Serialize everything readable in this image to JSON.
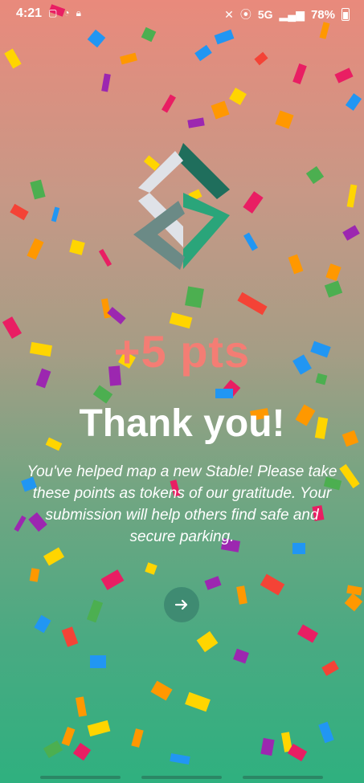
{
  "status_bar": {
    "time": "4:21",
    "network": "5G",
    "battery": "78%"
  },
  "main": {
    "points": "+5 pts",
    "title": "Thank you!",
    "message": "You've helped map a new Stable! Please take these points as tokens of our gratitude. Your submission will help others find safe and secure parking."
  },
  "colors": {
    "points": "#f47d74",
    "button": "#3f8b72",
    "logo_dark_green": "#1f6e5c",
    "logo_green": "#2aa57a",
    "logo_gray": "#6b8a86",
    "logo_light": "#dfe2e8"
  },
  "icons": [
    "screenshot-icon",
    "wifi-icon",
    "lock-icon",
    "mute-icon",
    "location-icon",
    "signal-icon",
    "battery-icon",
    "arrow-right-icon"
  ]
}
